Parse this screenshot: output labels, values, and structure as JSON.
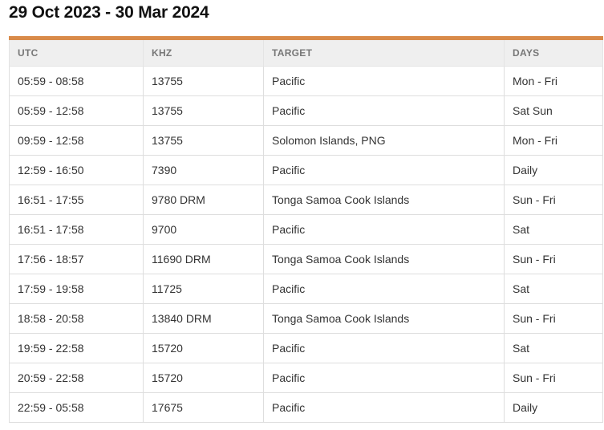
{
  "title": "29 Oct 2023 - 30 Mar 2024",
  "table": {
    "headers": [
      "UTC",
      "KHZ",
      "TARGET",
      "DAYS"
    ],
    "rows": [
      {
        "utc": "05:59 - 08:58",
        "khz": "13755",
        "target": "Pacific",
        "days": "Mon - Fri"
      },
      {
        "utc": "05:59 - 12:58",
        "khz": "13755",
        "target": "Pacific",
        "days": "Sat Sun"
      },
      {
        "utc": "09:59 - 12:58",
        "khz": "13755",
        "target": "Solomon Islands, PNG",
        "days": "Mon - Fri"
      },
      {
        "utc": "12:59 - 16:50",
        "khz": "7390",
        "target": "Pacific",
        "days": "Daily"
      },
      {
        "utc": "16:51 - 17:55",
        "khz": "9780 DRM",
        "target": "Tonga Samoa Cook Islands",
        "days": "Sun - Fri"
      },
      {
        "utc": "16:51 - 17:58",
        "khz": "9700",
        "target": "Pacific",
        "days": "Sat"
      },
      {
        "utc": "17:56 - 18:57",
        "khz": "11690 DRM",
        "target": "Tonga Samoa Cook Islands",
        "days": "Sun - Fri"
      },
      {
        "utc": "17:59 - 19:58",
        "khz": "11725",
        "target": "Pacific",
        "days": "Sat"
      },
      {
        "utc": "18:58 - 20:58",
        "khz": "13840 DRM",
        "target": "Tonga Samoa Cook Islands",
        "days": "Sun - Fri"
      },
      {
        "utc": "19:59 - 22:58",
        "khz": "15720",
        "target": "Pacific",
        "days": "Sat"
      },
      {
        "utc": "20:59 - 22:58",
        "khz": "15720",
        "target": "Pacific",
        "days": "Sun - Fri"
      },
      {
        "utc": "22:59 - 05:58",
        "khz": "17675",
        "target": "Pacific",
        "days": "Daily"
      }
    ]
  },
  "colors": {
    "accent": "#d98b4a",
    "header_bg": "#efefef",
    "header_text": "#777777"
  }
}
